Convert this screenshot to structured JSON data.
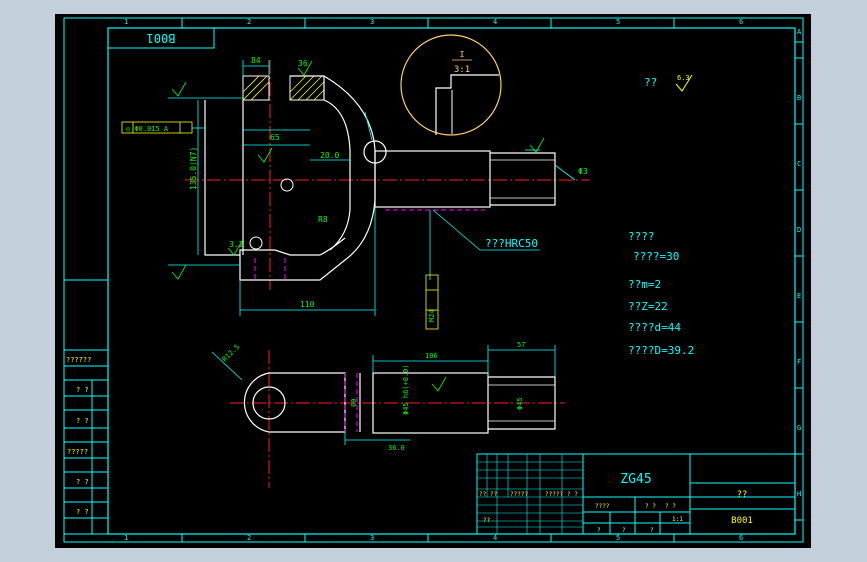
{
  "drawing": {
    "number": "B001",
    "material": "ZG45",
    "colors": {
      "background": "#000000",
      "frame": "#00ffff",
      "outline": "#ffffff",
      "center_line": "#ff2020",
      "dimension": "#00ffff",
      "annotation_text": "#00ff00",
      "hidden_line": "#ff00ff",
      "detail_circle": "#ffcc66",
      "hatch": "#ffff00"
    },
    "zone_letters": [
      "A",
      "B",
      "C",
      "D",
      "E",
      "F",
      "G",
      "H"
    ],
    "zone_numbers": [
      "1",
      "2",
      "3",
      "4",
      "5",
      "6"
    ],
    "detail_callout": {
      "letter": "I",
      "scale": "3:1"
    },
    "roughness": {
      "label": "??",
      "value": "6.3"
    },
    "heat_treatment": "???HRC50",
    "gear_params": {
      "title": "????",
      "teeth_line": "????=30",
      "module": "??m=2",
      "z": "??Z=22",
      "d": "????d=44",
      "D": "????D=39.2"
    },
    "left_block_labels": [
      "??????",
      "? ?",
      "? ?",
      "?????",
      "? ?",
      "? ?"
    ],
    "title_block": {
      "owner_label": "??",
      "grid_row_labels": [
        "?? ??",
        "?????",
        "?????",
        "? ?"
      ],
      "sub_labels": [
        "????",
        "? ?",
        "? ?",
        "??",
        "?",
        "?",
        "?"
      ],
      "sheet": "1:1"
    },
    "dimensions": {
      "top_width": "84",
      "dim_top_small": "36",
      "left_vertical": "135.0(N7)",
      "inner_width": "65",
      "slot": "20.0",
      "chamfer": "R8",
      "bottom_width": "110",
      "shaft_length": "106",
      "spline_length": "57",
      "spline_dia": "Φ45",
      "shaft_dia": "Φ45 h6(+0.0)",
      "hole_dia": "R12.5",
      "width_60": "60",
      "thread": "M24",
      "bottom_dim": "36.0",
      "arrow_label": "Φ3",
      "roughness_small": "3.2",
      "tolerance_box": "◎ Φ0.015  A"
    }
  }
}
